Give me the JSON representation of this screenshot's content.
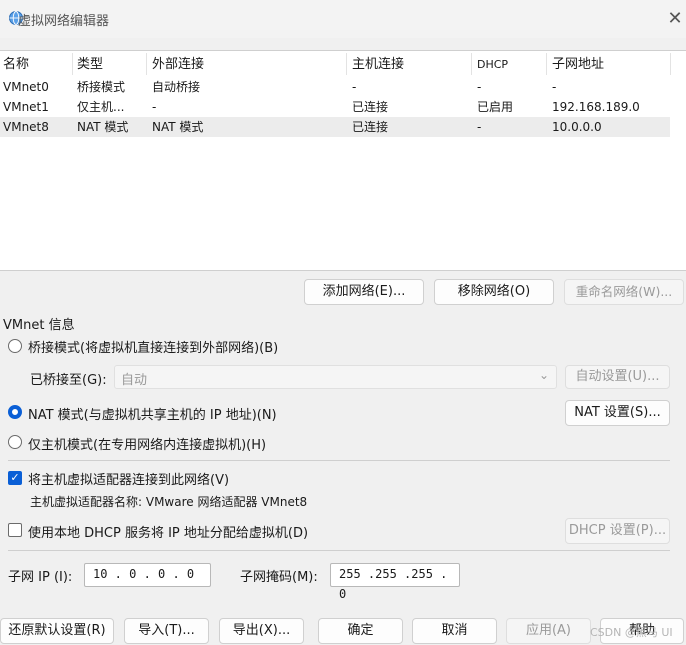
{
  "window": {
    "title": "虚拟网络编辑器"
  },
  "network_list": {
    "columns": [
      "名称",
      "类型",
      "外部连接",
      "主机连接",
      "DHCP",
      "子网地址"
    ],
    "rows": [
      {
        "name": "VMnet0",
        "type": "桥接模式",
        "external": "自动桥接",
        "host": "-",
        "dhcp": "-",
        "subnet": "-"
      },
      {
        "name": "VMnet1",
        "type": "仅主机...",
        "external": "-",
        "host": "已连接",
        "dhcp": "已启用",
        "subnet": "192.168.189.0"
      },
      {
        "name": "VMnet8",
        "type": "NAT 模式",
        "external": "NAT 模式",
        "host": "已连接",
        "dhcp": "-",
        "subnet": "10.0.0.0"
      }
    ],
    "selected_row": 2
  },
  "list_buttons": {
    "add": "添加网络(E)...",
    "remove": "移除网络(O)",
    "rename": "重命名网络(W)..."
  },
  "vmnet_info": {
    "group_label": "VMnet 信息",
    "bridged_radio": "桥接模式(将虚拟机直接连接到外部网络)(B)",
    "bridged_to_label": "已桥接至(G):",
    "bridged_to_value": "自动",
    "auto_settings_button": "自动设置(U)...",
    "nat_radio": "NAT 模式(与虚拟机共享主机的 IP 地址)(N)",
    "nat_settings_button": "NAT 设置(S)...",
    "hostonly_radio": "仅主机模式(在专用网络内连接虚拟机)(H)",
    "selected_mode": "nat",
    "connect_adapter_check": "将主机虚拟适配器连接到此网络(V)",
    "connect_adapter_checked": true,
    "adapter_name_text": "主机虚拟适配器名称: VMware 网络适配器 VMnet8",
    "dhcp_check": "使用本地 DHCP 服务将 IP 地址分配给虚拟机(D)",
    "dhcp_checked": false,
    "dhcp_settings_button": "DHCP 设置(P)...",
    "subnet_ip_label": "子网 IP (I):",
    "subnet_ip_value": "10 . 0 . 0 . 0",
    "subnet_mask_label": "子网掩码(M):",
    "subnet_mask_value": "255 .255 .255 . 0"
  },
  "footer": {
    "restore": "还原默认设置(R)",
    "import": "导入(T)...",
    "export": "导出(X)...",
    "ok": "确定",
    "cancel": "取消",
    "apply": "应用(A)",
    "help": "帮助",
    "watermark": "CSDN @黑马 UI"
  }
}
